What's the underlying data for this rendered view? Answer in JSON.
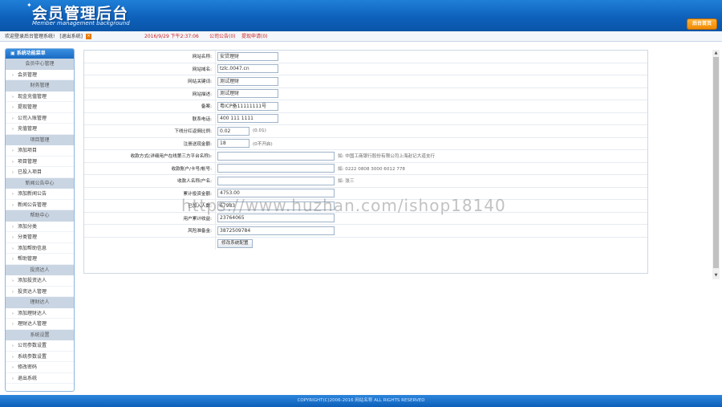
{
  "header": {
    "title": "会员管理后台",
    "subtitle": "Member management background",
    "home_label": "后台首页"
  },
  "infobar": {
    "welcome": "欢迎登录后台管理系统!",
    "logout": "[退出系统]",
    "datetime": "2016/9/29 下午2:37:06",
    "announcement": "公司公告(0)",
    "withdraw": "提现申请(0)"
  },
  "sidebar": {
    "title": "系统功能菜单",
    "sections": [
      {
        "label": "会员中心管理",
        "items": [
          "会员管理"
        ]
      },
      {
        "label": "财务管理",
        "items": [
          "现金充值管理",
          "提现管理",
          "公司入账管理",
          "充值管理"
        ]
      },
      {
        "label": "项目管理",
        "items": [
          "添加项目",
          "项目管理",
          "已投入项目"
        ]
      },
      {
        "label": "新闻公告中心",
        "items": [
          "添加新闻公告",
          "新闻公告管理"
        ]
      },
      {
        "label": "帮助中心",
        "items": [
          "添加分类",
          "分类管理",
          "添加帮助信息",
          "帮助管理"
        ]
      },
      {
        "label": "投资达人",
        "items": [
          "添加投资达人",
          "投资达人管理"
        ]
      },
      {
        "label": "理财达人",
        "items": [
          "添加理财达人",
          "理财达人管理"
        ]
      },
      {
        "label": "系统设置",
        "items": [
          "公司参数设置",
          "系统参数设置",
          "修改密码",
          "退出系统"
        ]
      }
    ]
  },
  "form": {
    "rows": [
      {
        "label": "网站名称:",
        "value": "安贷理财",
        "width": 76
      },
      {
        "label": "网站域名:",
        "value": "tzlc.0047.cn",
        "width": 76
      },
      {
        "label": "网站关键词:",
        "value": "测试理财",
        "width": 76
      },
      {
        "label": "网站描述:",
        "value": "测试理财",
        "width": 76
      },
      {
        "label": "备案:",
        "value": "粤ICP备11111111号",
        "width": 76
      },
      {
        "label": "联系电话:",
        "value": "400 111 1111",
        "width": 76
      },
      {
        "label": "下线分红返佣比例:",
        "value": "0.02",
        "width": 40,
        "note": "(0.01)"
      },
      {
        "label": "注册送现金额:",
        "value": "18",
        "width": 40,
        "note": "(0不开启)"
      },
      {
        "label": "收款方式(详细用户在线第三方平台名称):",
        "value": "",
        "width": 146,
        "note": "如: 中国工商银行股份有限公司上海赵记大道支行"
      },
      {
        "label": "收款账户/卡号/帐号:",
        "value": "",
        "width": 146,
        "note": "如: 0222 0808 3000 6012 778"
      },
      {
        "label": "收款人名称/户名:",
        "value": "",
        "width": 146,
        "note": "如: 张三"
      },
      {
        "label": "累计投资金额:",
        "value": "4753.00",
        "width": 146
      },
      {
        "label": "已加入人数:",
        "value": "67983",
        "width": 146
      },
      {
        "label": "用户累计收益:",
        "value": "23764065",
        "width": 146
      },
      {
        "label": "风险准备金:",
        "value": "3872509784",
        "width": 146
      }
    ],
    "submit_label": "修改系统配置"
  },
  "footer": {
    "copyright": "COPYRIGHT(C)2006-2016 网站名称 ALL RIGHTS RESERVED"
  },
  "watermark": "https://www.huzhan.com/ishop18140",
  "colors": {
    "header_blue": "#0d5fb8",
    "accent_orange": "#f08a00",
    "section_gray": "#c9d5e3",
    "date_red": "#cc2222"
  }
}
